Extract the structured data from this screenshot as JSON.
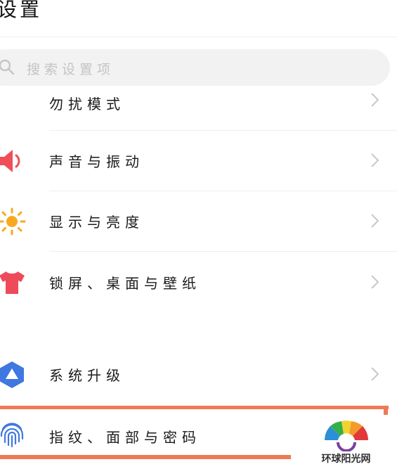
{
  "header": {
    "title": "设置"
  },
  "search": {
    "placeholder": "搜索设置项",
    "icon": "search-icon"
  },
  "items": [
    {
      "label": "勿扰模式",
      "icon": "moon-icon",
      "icon_color": "#a86be0"
    },
    {
      "label": "声音与振动",
      "icon": "speaker-icon",
      "icon_color": "#f04f59"
    },
    {
      "label": "显示与亮度",
      "icon": "sun-icon",
      "icon_color": "#f8a922"
    },
    {
      "label": "锁屏、桌面与壁纸",
      "icon": "tshirt-icon",
      "icon_color": "#ef4a59"
    },
    {
      "label": "系统升级",
      "icon": "upgrade-icon",
      "icon_color": "#3f78e0"
    },
    {
      "label": "指纹、面部与密码",
      "icon": "fingerprint-icon",
      "icon_color": "#3f78e0"
    }
  ],
  "watermark": {
    "text": "环球阳光网"
  },
  "colors": {
    "highlight": "#ee7a54",
    "chevron": "#c8c8c8"
  }
}
